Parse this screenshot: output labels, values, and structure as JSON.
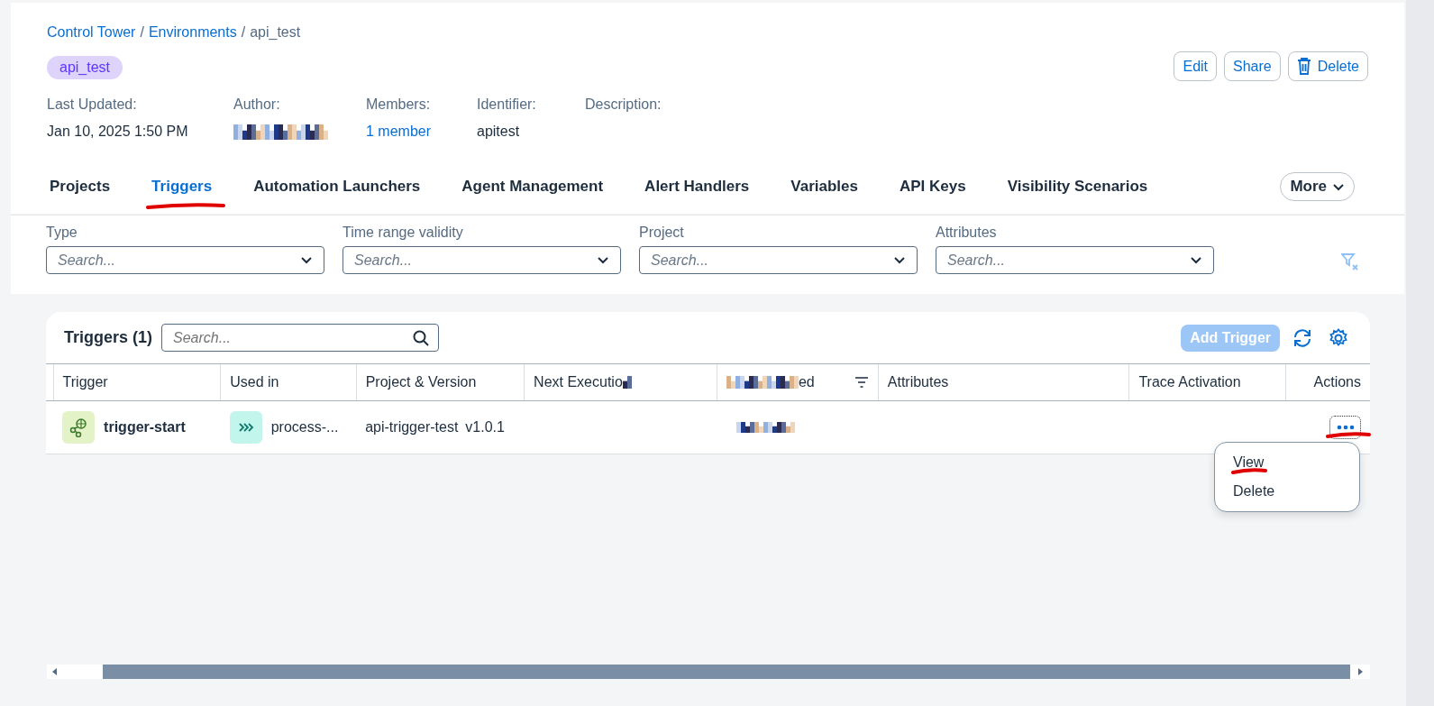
{
  "breadcrumb": {
    "separator": "/",
    "items": [
      {
        "label": "Control Tower",
        "link": true
      },
      {
        "label": "Environments",
        "link": true
      },
      {
        "label": "api_test",
        "link": false
      }
    ]
  },
  "title_tag": "api_test",
  "header_actions": [
    {
      "label": "Edit",
      "kind": "text"
    },
    {
      "label": "Share",
      "kind": "text"
    },
    {
      "label": "Delete",
      "kind": "delete"
    }
  ],
  "details": [
    {
      "label": "Last Updated:",
      "kind": "text",
      "value": "Jan 10, 2025 1:50 PM"
    },
    {
      "label": "Author:",
      "kind": "redacted"
    },
    {
      "label": "Members:",
      "kind": "link",
      "value": "1 member"
    },
    {
      "label": "Identifier:",
      "kind": "text",
      "value": "apitest"
    },
    {
      "label": "Description:",
      "kind": "text"
    }
  ],
  "tabs": [
    {
      "label": "Projects",
      "selected": false
    },
    {
      "label": "Triggers",
      "selected": true
    },
    {
      "label": "Automation Launchers",
      "selected": false
    },
    {
      "label": "Agent Management",
      "selected": false
    },
    {
      "label": "Alert Handlers",
      "selected": false
    },
    {
      "label": "Variables",
      "selected": false
    },
    {
      "label": "API Keys",
      "selected": false
    },
    {
      "label": "Visibility Scenarios",
      "selected": false
    }
  ],
  "more_button": "More",
  "filters": [
    {
      "label": "Type",
      "placeholder": "Search..."
    },
    {
      "label": "Time range validity",
      "placeholder": "Search..."
    },
    {
      "label": "Project",
      "placeholder": "Search..."
    },
    {
      "label": "Attributes",
      "placeholder": "Search..."
    }
  ],
  "table": {
    "title": "Triggers (1)",
    "search_placeholder": "Search...",
    "add_button": {
      "label": "Add Trigger",
      "disabled": true
    },
    "columns": [
      {
        "label": "Trigger",
        "kind": "text"
      },
      {
        "label": "Used in",
        "kind": "text"
      },
      {
        "label": "Project & Version",
        "kind": "text"
      },
      {
        "label": "Next Executio",
        "kind": "redacted_after"
      },
      {
        "label": "ed",
        "kind": "redacted_before_sort"
      },
      {
        "label": "Attributes",
        "kind": "text"
      },
      {
        "label": "Trace Activation",
        "kind": "text"
      },
      {
        "label": "Actions",
        "kind": "right"
      }
    ],
    "rows": [
      {
        "trigger": "trigger-start",
        "used_in": "process-...",
        "project": "api-trigger-test",
        "version": "v1.0.1",
        "last_updated_redacted": true
      }
    ]
  },
  "row_menu": {
    "open": true,
    "items": [
      {
        "label": "View",
        "annotated": true
      },
      {
        "label": "Delete",
        "annotated": false
      }
    ]
  },
  "annotations": {
    "tab_underline": true,
    "actions_underline": true
  }
}
